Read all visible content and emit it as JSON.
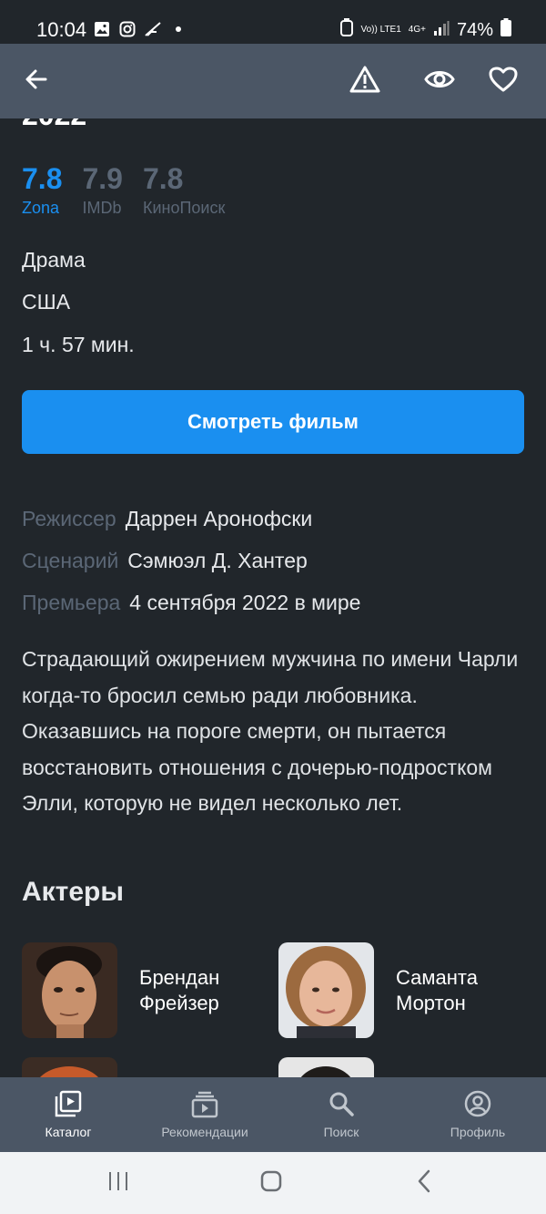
{
  "status_bar": {
    "time": "10:04",
    "battery": "74%",
    "volte": "Vo)) LTE1",
    "network": "4G+",
    "notification_icons": [
      "gallery-icon",
      "instagram-icon",
      "feather-icon",
      "dot-icon"
    ]
  },
  "app_bar": {
    "back_icon": "arrow-left-icon",
    "report_icon": "warning-icon",
    "watched_icon": "eye-icon",
    "favorite_icon": "heart-icon"
  },
  "movie": {
    "year": "2022",
    "ratings": [
      {
        "value": "7.8",
        "source": "Zona"
      },
      {
        "value": "7.9",
        "source": "IMDb"
      },
      {
        "value": "7.8",
        "source": "КиноПоиск"
      }
    ],
    "genre": "Драма",
    "country": "США",
    "duration": "1 ч. 57 мин.",
    "watch_button": "Смотреть фильм",
    "crew": [
      {
        "label": "Режиссер",
        "value": "Даррен Аронофски"
      },
      {
        "label": "Сценарий",
        "value": "Сэмюэл Д. Хантер"
      },
      {
        "label": "Премьера",
        "value": "4 сентября 2022 в мире"
      }
    ],
    "description": "Страдающий ожирением мужчина по имени Чарли когда-то бросил семью ради любовника. Оказавшись на пороге смерти, он пытается восстановить отношения с дочерью-подростком Элли, которую не видел несколько лет.",
    "actors_title": "Актеры",
    "actors": [
      {
        "name": "Брендан Фрейзер"
      },
      {
        "name": "Саманта Мортон"
      }
    ]
  },
  "bottom_nav": {
    "items": [
      {
        "label": "Каталог",
        "icon": "play-library-icon",
        "active": true
      },
      {
        "label": "Рекомендации",
        "icon": "recommendations-icon",
        "active": false
      },
      {
        "label": "Поиск",
        "icon": "search-icon",
        "active": false
      },
      {
        "label": "Профиль",
        "icon": "profile-icon",
        "active": false
      }
    ]
  },
  "colors": {
    "accent": "#1a8ff0",
    "background": "#21262b",
    "bar": "#4b5665",
    "muted": "#5b6776"
  }
}
